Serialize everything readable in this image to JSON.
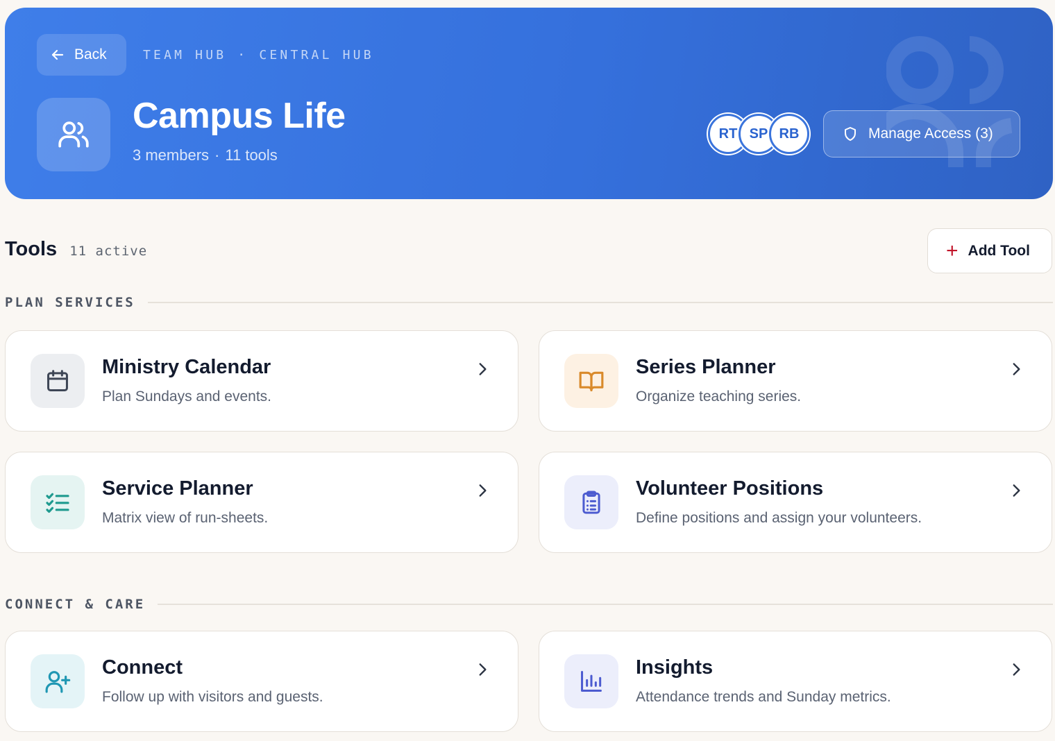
{
  "header": {
    "back_label": "Back",
    "crumb_1": "TEAM HUB",
    "crumb_sep": "·",
    "crumb_2": "CENTRAL HUB",
    "team_name": "Campus Life",
    "members": "3 members",
    "meta_sep": "·",
    "tools": "11 tools",
    "avatars": [
      "RT",
      "SP",
      "RB"
    ],
    "manage_label": "Manage Access (3)"
  },
  "tools_section": {
    "title": "Tools",
    "count": "11 active",
    "add_label": "Add Tool"
  },
  "groups": [
    {
      "label": "PLAN SERVICES",
      "cards": [
        {
          "title": "Ministry Calendar",
          "desc": "Plan Sundays and events.",
          "icon": "calendar-icon",
          "icon_bg": "#eceef1",
          "icon_color": "#3e4656"
        },
        {
          "title": "Series Planner",
          "desc": "Organize teaching series.",
          "icon": "book-open-icon",
          "icon_bg": "#fdf1e3",
          "icon_color": "#d98a2b"
        },
        {
          "title": "Service Planner",
          "desc": "Matrix view of run-sheets.",
          "icon": "list-checks-icon",
          "icon_bg": "#e5f4f2",
          "icon_color": "#1f9a8f"
        },
        {
          "title": "Volunteer Positions",
          "desc": "Define positions and assign your volunteers.",
          "icon": "clipboard-list-icon",
          "icon_bg": "#eceefb",
          "icon_color": "#4c5bd0"
        }
      ]
    },
    {
      "label": "CONNECT & CARE",
      "cards": [
        {
          "title": "Connect",
          "desc": "Follow up with visitors and guests.",
          "icon": "user-plus-icon",
          "icon_bg": "#e4f4f7",
          "icon_color": "#1f97b3"
        },
        {
          "title": "Insights",
          "desc": "Attendance trends and Sunday metrics.",
          "icon": "bar-chart-icon",
          "icon_bg": "#eceefb",
          "icon_color": "#4c5bd0"
        }
      ]
    }
  ]
}
